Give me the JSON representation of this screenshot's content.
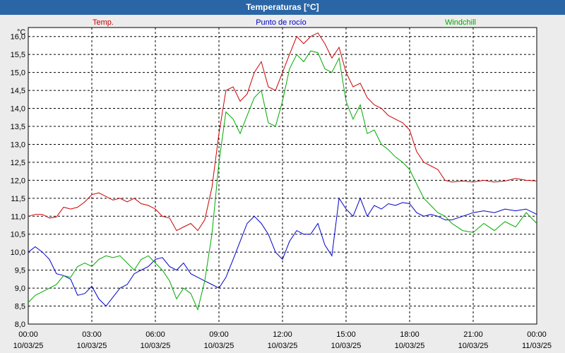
{
  "window": {
    "title": "Temperaturas [°C]"
  },
  "chart_data": {
    "type": "line",
    "title": "Temperaturas [°C]",
    "ylabel": "°C",
    "ylim": [
      8.0,
      16.25
    ],
    "y_ticks": [
      "8,0",
      "8,5",
      "9,0",
      "9,5",
      "10,0",
      "10,5",
      "11,0",
      "11,5",
      "12,0",
      "12,5",
      "13,0",
      "13,5",
      "14,0",
      "14,5",
      "15,0",
      "15,5",
      "16,0"
    ],
    "xlim": [
      0,
      24
    ],
    "x_ticks": [
      {
        "h": 0,
        "time": "00:00",
        "date": "10/03/25"
      },
      {
        "h": 3,
        "time": "03:00",
        "date": "10/03/25"
      },
      {
        "h": 6,
        "time": "06:00",
        "date": "10/03/25"
      },
      {
        "h": 9,
        "time": "09:00",
        "date": "10/03/25"
      },
      {
        "h": 12,
        "time": "12:00",
        "date": "10/03/25"
      },
      {
        "h": 15,
        "time": "15:00",
        "date": "10/03/25"
      },
      {
        "h": 18,
        "time": "18:00",
        "date": "10/03/25"
      },
      {
        "h": 21,
        "time": "21:00",
        "date": "10/03/25"
      },
      {
        "h": 24,
        "time": "00:00",
        "date": "11/03/25"
      }
    ],
    "grid": true,
    "legend_position": "top",
    "series": [
      {
        "name": "Temp.",
        "color": "#cc0000",
        "x": [
          0,
          0.33,
          0.67,
          1.0,
          1.33,
          1.67,
          2.0,
          2.33,
          2.67,
          3.0,
          3.33,
          3.67,
          4.0,
          4.33,
          4.67,
          5.0,
          5.33,
          5.67,
          6.0,
          6.33,
          6.67,
          7.0,
          7.33,
          7.67,
          8.0,
          8.33,
          8.67,
          9.0,
          9.33,
          9.67,
          10.0,
          10.33,
          10.67,
          11.0,
          11.33,
          11.67,
          12.0,
          12.33,
          12.67,
          13.0,
          13.33,
          13.67,
          14.0,
          14.33,
          14.67,
          15.0,
          15.33,
          15.67,
          16.0,
          16.33,
          16.67,
          17.0,
          17.33,
          17.67,
          18.0,
          18.33,
          18.67,
          19.0,
          19.33,
          19.67,
          20.0,
          20.5,
          21.0,
          21.5,
          22.0,
          22.5,
          23.0,
          23.5,
          24.0
        ],
        "values": [
          11.0,
          11.05,
          11.05,
          10.95,
          10.98,
          11.25,
          11.2,
          11.25,
          11.4,
          11.6,
          11.65,
          11.55,
          11.45,
          11.5,
          11.4,
          11.5,
          11.35,
          11.3,
          11.2,
          11.0,
          10.95,
          10.6,
          10.7,
          10.8,
          10.6,
          10.9,
          11.8,
          13.3,
          14.5,
          14.6,
          14.2,
          14.4,
          15.0,
          15.3,
          14.6,
          14.5,
          15.0,
          15.5,
          16.0,
          15.8,
          16.0,
          16.1,
          15.8,
          15.4,
          15.7,
          15.0,
          14.6,
          14.7,
          14.3,
          14.1,
          14.0,
          13.8,
          13.7,
          13.6,
          13.4,
          12.8,
          12.5,
          12.4,
          12.3,
          12.0,
          11.95,
          11.98,
          11.95,
          12.0,
          11.95,
          11.98,
          12.05,
          12.0,
          11.98
        ]
      },
      {
        "name": "Punto de rocío",
        "color": "#0000cc",
        "x": [
          0,
          0.33,
          0.67,
          1.0,
          1.33,
          1.67,
          2.0,
          2.33,
          2.67,
          3.0,
          3.33,
          3.67,
          4.0,
          4.33,
          4.67,
          5.0,
          5.33,
          5.67,
          6.0,
          6.33,
          6.67,
          7.0,
          7.33,
          7.67,
          8.0,
          8.33,
          8.67,
          9.0,
          9.33,
          9.67,
          10.0,
          10.33,
          10.67,
          11.0,
          11.33,
          11.67,
          12.0,
          12.33,
          12.67,
          13.0,
          13.33,
          13.67,
          14.0,
          14.33,
          14.67,
          15.0,
          15.33,
          15.67,
          16.0,
          16.33,
          16.67,
          17.0,
          17.33,
          17.67,
          18.0,
          18.33,
          18.67,
          19.0,
          19.33,
          19.67,
          20.0,
          20.5,
          21.0,
          21.5,
          22.0,
          22.5,
          23.0,
          23.5,
          24.0
        ],
        "values": [
          10.0,
          10.15,
          10.0,
          9.8,
          9.4,
          9.35,
          9.25,
          8.8,
          8.85,
          9.05,
          8.7,
          8.5,
          8.75,
          9.0,
          9.1,
          9.4,
          9.5,
          9.6,
          9.8,
          9.85,
          9.6,
          9.5,
          9.7,
          9.4,
          9.3,
          9.2,
          9.1,
          9.0,
          9.3,
          9.8,
          10.3,
          10.8,
          11.0,
          10.8,
          10.5,
          10.0,
          9.8,
          10.3,
          10.6,
          10.5,
          10.5,
          10.8,
          10.2,
          9.9,
          11.5,
          11.2,
          11.0,
          11.5,
          11.0,
          11.3,
          11.2,
          11.35,
          11.3,
          11.38,
          11.35,
          11.1,
          11.0,
          11.05,
          11.0,
          10.9,
          10.9,
          11.0,
          11.1,
          11.15,
          11.1,
          11.2,
          11.15,
          11.2,
          11.05
        ]
      },
      {
        "name": "Windchill",
        "color": "#00aa00",
        "x": [
          0,
          0.33,
          0.67,
          1.0,
          1.33,
          1.67,
          2.0,
          2.33,
          2.67,
          3.0,
          3.33,
          3.67,
          4.0,
          4.33,
          4.67,
          5.0,
          5.33,
          5.67,
          6.0,
          6.33,
          6.67,
          7.0,
          7.33,
          7.67,
          8.0,
          8.33,
          8.67,
          9.0,
          9.33,
          9.67,
          10.0,
          10.33,
          10.67,
          11.0,
          11.33,
          11.67,
          12.0,
          12.33,
          12.67,
          13.0,
          13.33,
          13.67,
          14.0,
          14.33,
          14.67,
          15.0,
          15.33,
          15.67,
          16.0,
          16.33,
          16.67,
          17.0,
          17.33,
          17.67,
          18.0,
          18.33,
          18.67,
          19.0,
          19.33,
          19.67,
          20.0,
          20.5,
          21.0,
          21.5,
          22.0,
          22.5,
          23.0,
          23.5,
          24.0
        ],
        "values": [
          8.6,
          8.8,
          8.9,
          9.0,
          9.1,
          9.35,
          9.3,
          9.6,
          9.7,
          9.6,
          9.8,
          9.9,
          9.85,
          9.9,
          9.7,
          9.5,
          9.8,
          9.9,
          9.7,
          9.5,
          9.2,
          8.7,
          9.0,
          8.85,
          8.4,
          9.2,
          10.5,
          12.5,
          13.9,
          13.7,
          13.3,
          13.8,
          14.3,
          14.5,
          13.6,
          13.5,
          14.2,
          15.1,
          15.5,
          15.3,
          15.6,
          15.55,
          15.1,
          15.0,
          15.4,
          14.2,
          13.7,
          14.1,
          13.3,
          13.4,
          13.0,
          12.85,
          12.65,
          12.5,
          12.3,
          11.9,
          11.5,
          11.3,
          11.1,
          11.0,
          10.8,
          10.6,
          10.55,
          10.8,
          10.6,
          10.85,
          10.7,
          11.1,
          10.8
        ]
      }
    ]
  }
}
